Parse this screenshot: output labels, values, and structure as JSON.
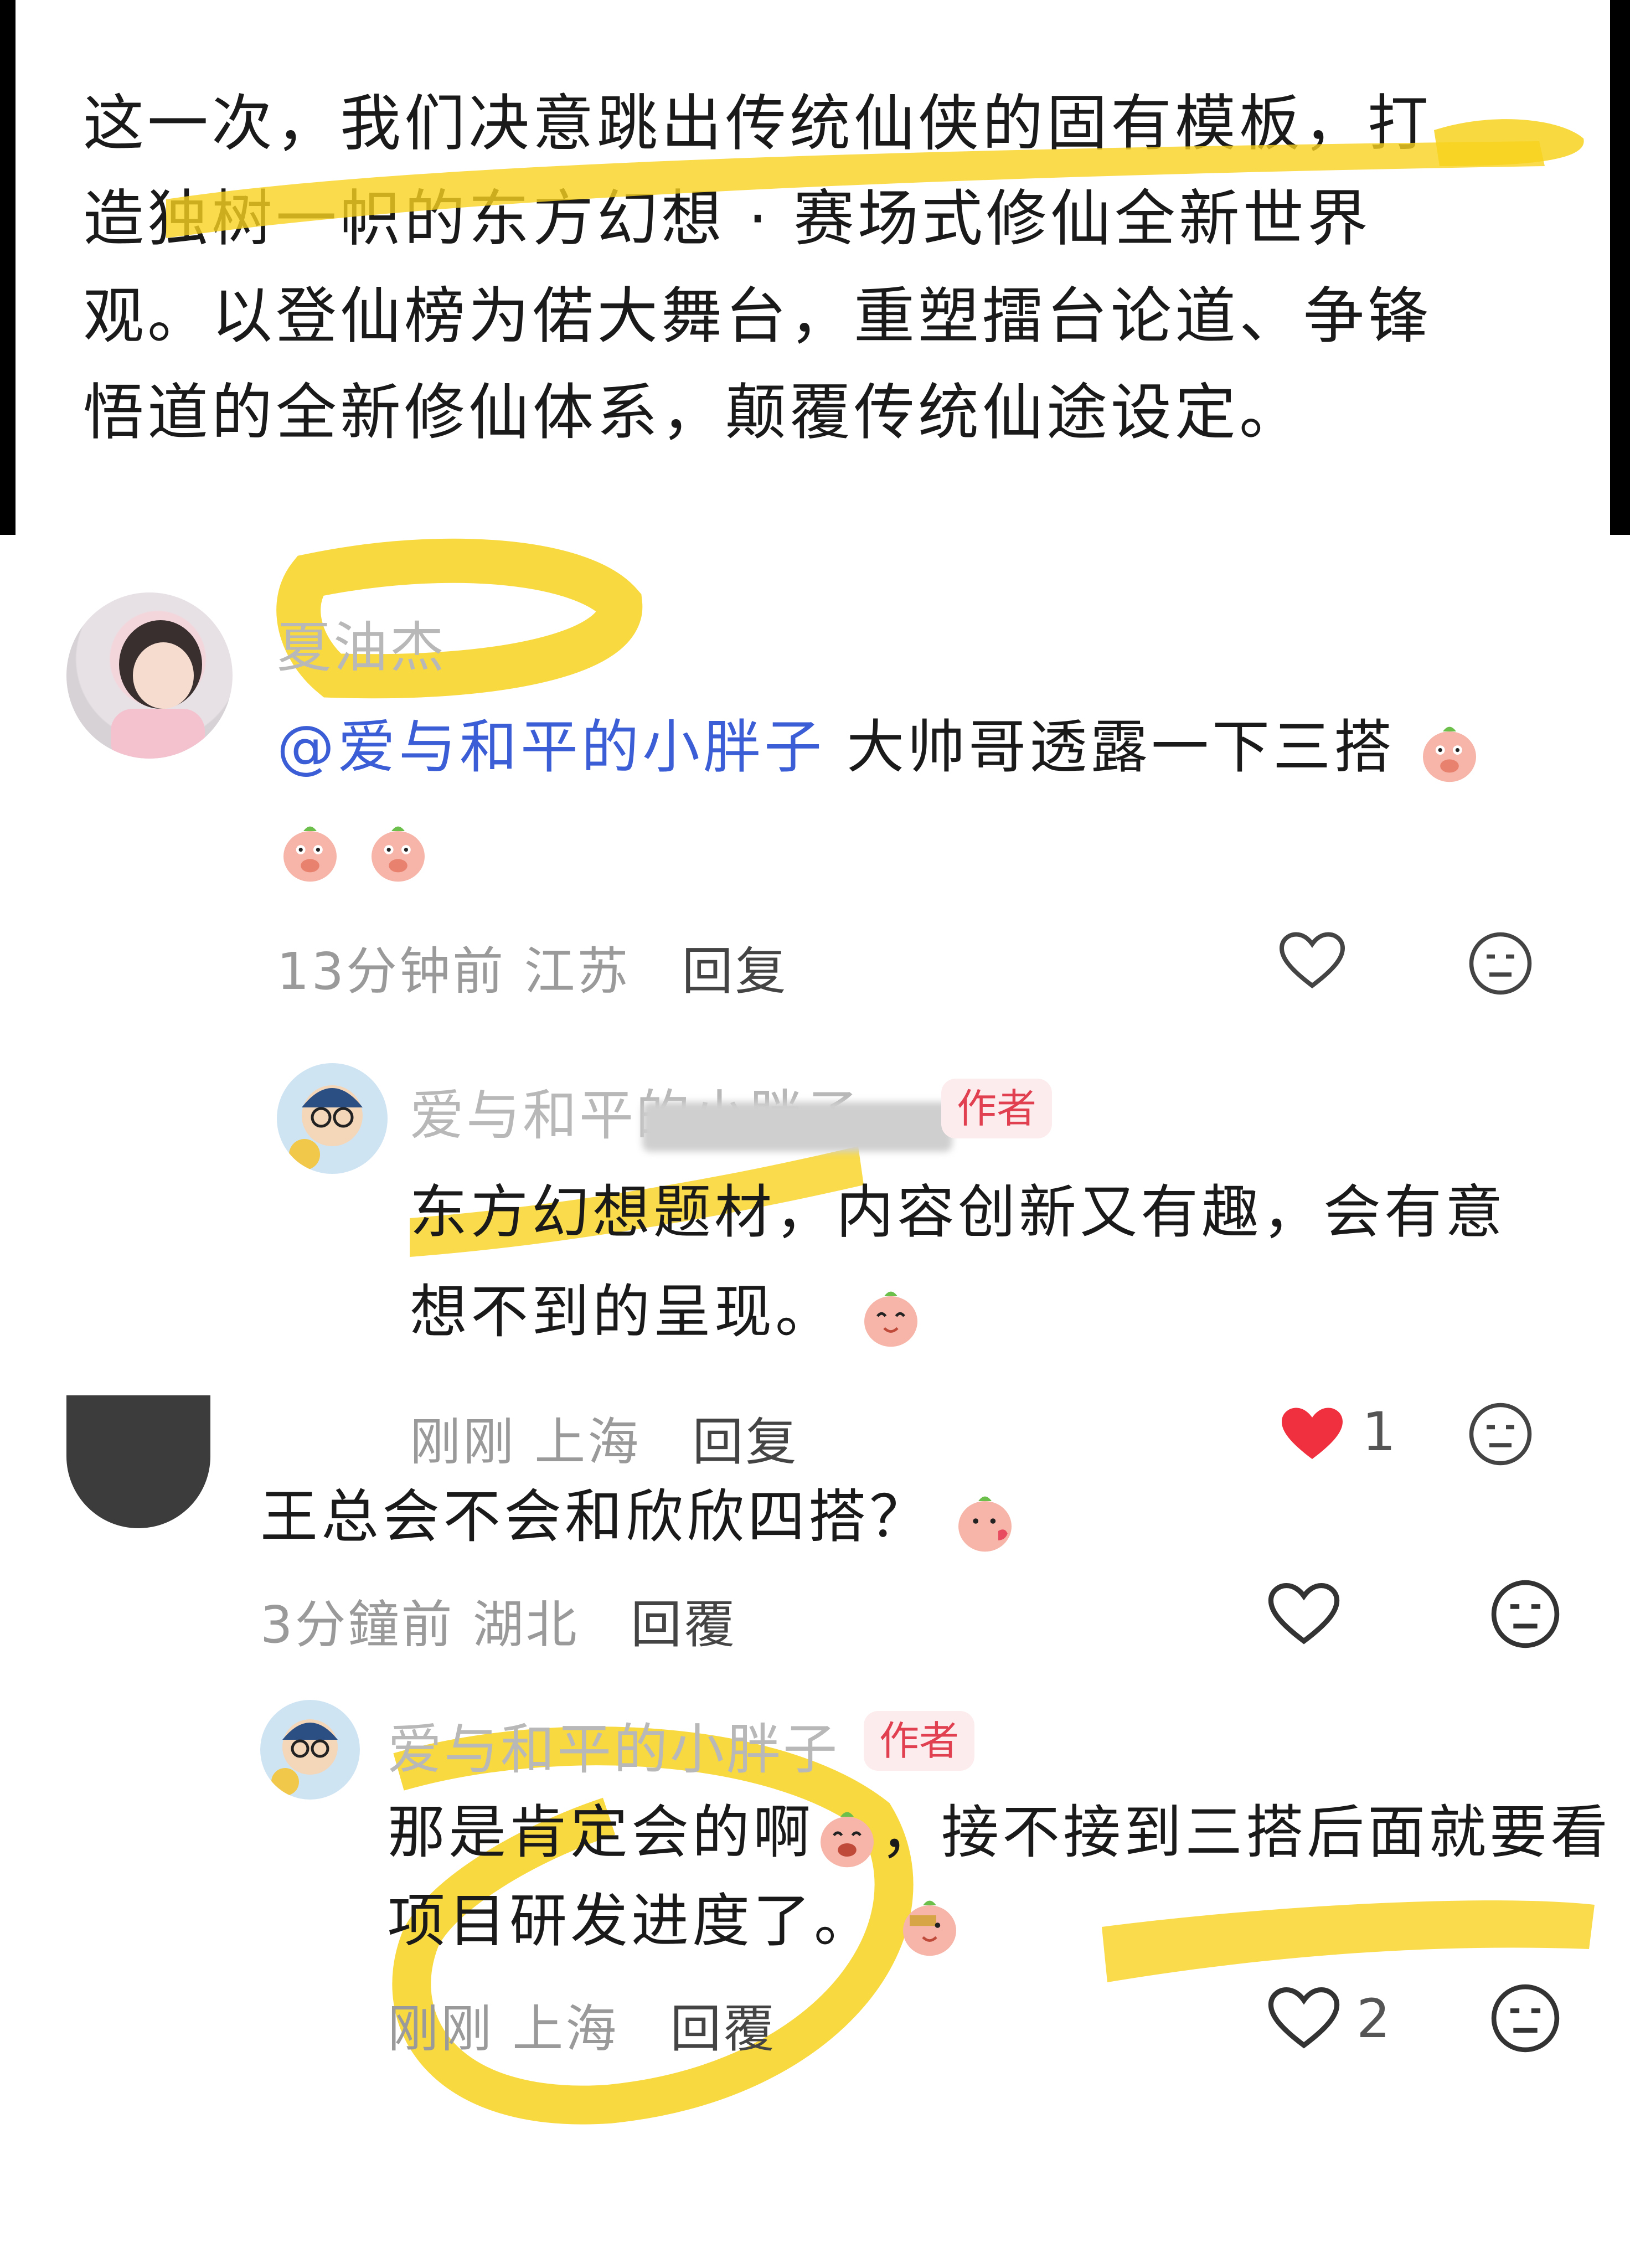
{
  "article": {
    "lines": [
      "这一次，我们决意跳出传统仙侠的固有模板，打",
      "造独树一帜的东方幻想 · 赛场式修仙全新世界",
      "观。以登仙榜为偌大舞台，重塑擂台论道、争锋",
      "悟道的全新修仙体系，颠覆传统仙途设定。"
    ]
  },
  "comments": [
    {
      "username": "夏油杰",
      "mention": "@爱与和平的小胖子",
      "text_line1": "大帅哥透露一下三搭",
      "meta_time": "13分钟前",
      "meta_location": "江苏",
      "reply_label": "回复",
      "reply": {
        "username": "爱与和平的小胖子",
        "badge": "作者",
        "text_line1": "东方幻想题材，内容创新又有趣，会有意",
        "text_line2": "想不到的呈现。",
        "meta_time": "刚刚",
        "meta_location": "上海",
        "reply_label": "回复",
        "like_count": "1"
      }
    },
    {
      "text_line1": "王总会不会和欣欣四搭？",
      "meta_time": "3分鐘前",
      "meta_location": "湖北",
      "reply_label": "回覆",
      "reply": {
        "username": "爱与和平的小胖子",
        "badge": "作者",
        "text_line1": "那是肯定会的啊",
        "text_line1b": "，接不接到三搭后面就要看",
        "text_line2": "项目研发进度了。",
        "meta_time": "刚刚",
        "meta_location": "上海",
        "reply_label": "回覆",
        "like_count": "2"
      }
    }
  ],
  "colors": {
    "highlighter": "#f7d21e",
    "liked_heart": "#f0303f",
    "mention": "#3b5dd6",
    "author_badge_bg": "#fdecee",
    "author_badge_text": "#e0404f"
  }
}
